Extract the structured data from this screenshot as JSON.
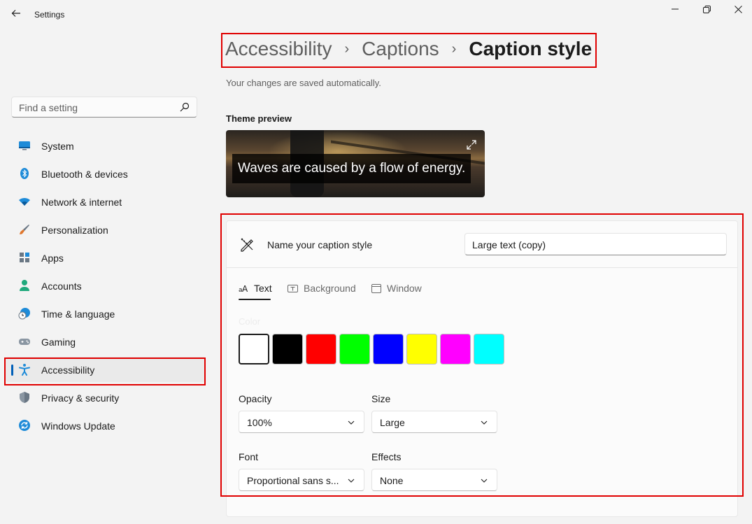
{
  "window": {
    "title": "Settings",
    "controls": {
      "minimize": "minimize",
      "maximize": "maximize",
      "close": "close"
    }
  },
  "search": {
    "placeholder": "Find a setting"
  },
  "sidebar": {
    "items": [
      {
        "label": "System",
        "icon": "monitor-icon",
        "color": "#1e8bd8"
      },
      {
        "label": "Bluetooth & devices",
        "icon": "bluetooth-icon",
        "color": "#1e8bd8"
      },
      {
        "label": "Network & internet",
        "icon": "wifi-icon",
        "color": "#1e8bd8"
      },
      {
        "label": "Personalization",
        "icon": "paintbrush-icon",
        "color": "#e0762b"
      },
      {
        "label": "Apps",
        "icon": "apps-icon",
        "color": "#6a7784"
      },
      {
        "label": "Accounts",
        "icon": "person-icon",
        "color": "#1fa97c"
      },
      {
        "label": "Time & language",
        "icon": "clock-globe-icon",
        "color": "#1e8bd8"
      },
      {
        "label": "Gaming",
        "icon": "gamepad-icon",
        "color": "#6a7784"
      },
      {
        "label": "Accessibility",
        "icon": "accessibility-icon",
        "color": "#1e8bd8",
        "selected": true
      },
      {
        "label": "Privacy & security",
        "icon": "shield-icon",
        "color": "#6a7784"
      },
      {
        "label": "Windows Update",
        "icon": "update-icon",
        "color": "#1e8bd8"
      }
    ]
  },
  "breadcrumb": {
    "items": [
      "Accessibility",
      "Captions"
    ],
    "current": "Caption style"
  },
  "subtitle": "Your changes are saved automatically.",
  "preview": {
    "label": "Theme preview",
    "caption": "Waves are caused by a flow of energy."
  },
  "name_row": {
    "label": "Name your caption style",
    "value": "Large text (copy)"
  },
  "tabs": [
    {
      "label": "Text",
      "icon": "text-size-icon",
      "selected": true
    },
    {
      "label": "Background",
      "icon": "text-box-icon",
      "selected": false
    },
    {
      "label": "Window",
      "icon": "window-icon",
      "selected": false
    }
  ],
  "text_tab": {
    "color_label": "Color",
    "colors": [
      "#ffffff",
      "#000000",
      "#ff0000",
      "#00ff00",
      "#0000ff",
      "#ffff00",
      "#ff00ff",
      "#00ffff"
    ],
    "selected_color": "#ffffff",
    "opacity": {
      "label": "Opacity",
      "value": "100%"
    },
    "size": {
      "label": "Size",
      "value": "Large"
    },
    "font": {
      "label": "Font",
      "value": "Proportional sans s..."
    },
    "effects": {
      "label": "Effects",
      "value": "None"
    }
  },
  "accent": "#005fb8",
  "highlight_color": "#e00000"
}
